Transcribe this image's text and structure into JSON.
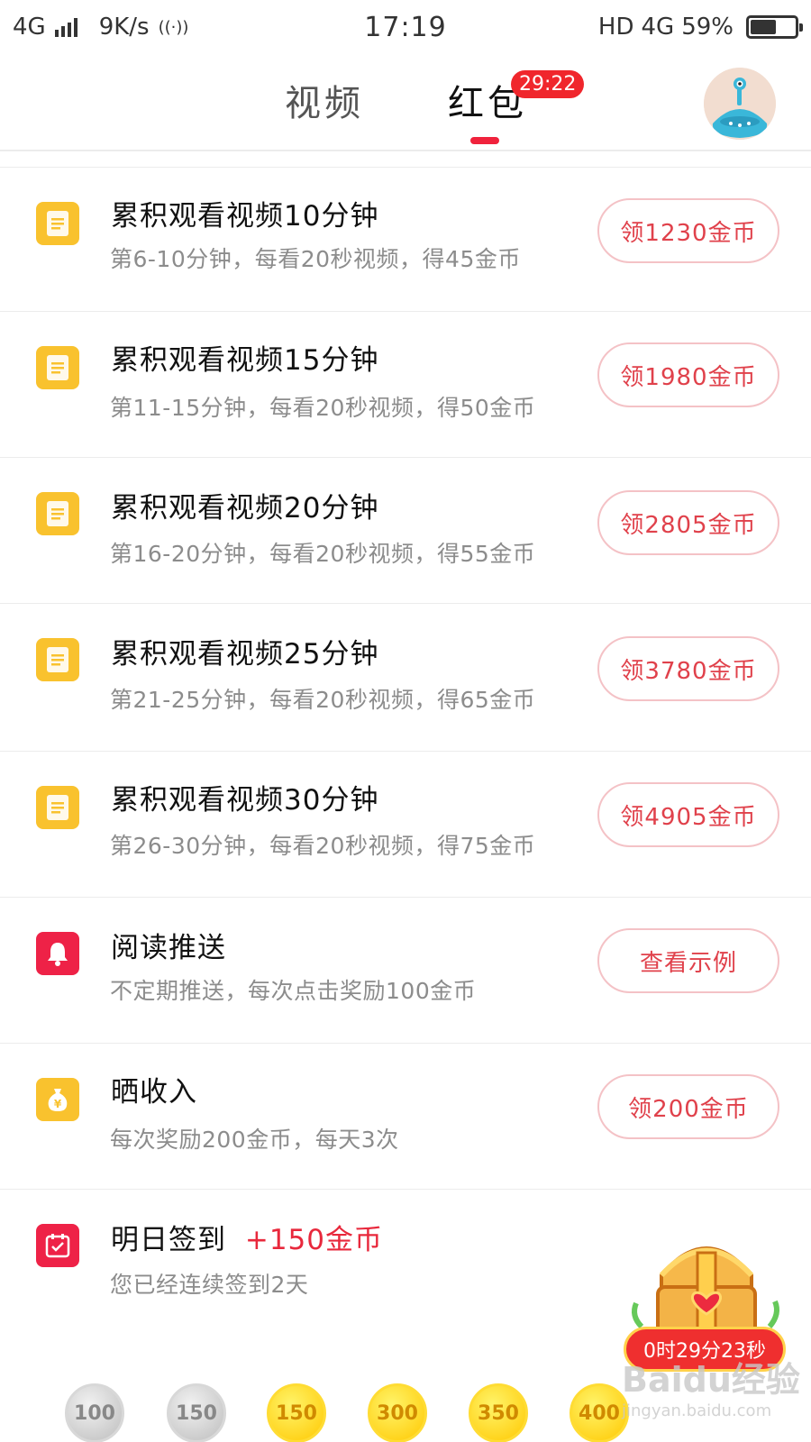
{
  "status_bar": {
    "network": "4G",
    "speed": "9K/s",
    "time": "17:19",
    "hd": "HD",
    "network_right": "4G",
    "battery_text": "59%",
    "battery_level": 0.59
  },
  "header": {
    "tabs": [
      {
        "label": "视频"
      },
      {
        "label": "红包"
      }
    ],
    "active_tab": "红包",
    "timer_badge": "29:22"
  },
  "tasks": [
    {
      "title": "累积观看视频10分钟",
      "desc": "第6-10分钟，每看20秒视频，得45金币",
      "button": "领1230金币",
      "icon": "document-icon",
      "icon_color": "#f9c22e"
    },
    {
      "title": "累积观看视频15分钟",
      "desc": "第11-15分钟，每看20秒视频，得50金币",
      "button": "领1980金币",
      "icon": "document-icon",
      "icon_color": "#f9c22e"
    },
    {
      "title": "累积观看视频20分钟",
      "desc": "第16-20分钟，每看20秒视频，得55金币",
      "button": "领2805金币",
      "icon": "document-icon",
      "icon_color": "#f9c22e"
    },
    {
      "title": "累积观看视频25分钟",
      "desc": "第21-25分钟，每看20秒视频，得65金币",
      "button": "领3780金币",
      "icon": "document-icon",
      "icon_color": "#f9c22e"
    },
    {
      "title": "累积观看视频30分钟",
      "desc": "第26-30分钟，每看20秒视频，得75金币",
      "button": "领4905金币",
      "icon": "document-icon",
      "icon_color": "#f9c22e"
    },
    {
      "title": "阅读推送",
      "desc": "不定期推送，每次点击奖励100金币",
      "button": "查看示例",
      "icon": "bell-icon",
      "icon_color": "#ee2247"
    },
    {
      "title": "晒收入",
      "desc": "每次奖励200金币，每天3次",
      "button": "领200金币",
      "icon": "money-bag-icon",
      "icon_color": "#f9c22e"
    }
  ],
  "checkin": {
    "title": "明日签到",
    "reward": "+150金币",
    "desc": "您已经连续签到2天",
    "icon": "calendar-check-icon",
    "icon_color": "#ee2247"
  },
  "chest": {
    "timer": "0时29分23秒",
    "icon": "treasure-chest-icon"
  },
  "coins": [
    {
      "value": "100",
      "state": "collected"
    },
    {
      "value": "150",
      "state": "collected"
    },
    {
      "value": "150",
      "state": "available"
    },
    {
      "value": "300",
      "state": "available"
    },
    {
      "value": "350",
      "state": "available"
    },
    {
      "value": "400",
      "state": "available"
    }
  ],
  "watermark": {
    "text": "Baidu经验",
    "url": "jingyan.baidu.com"
  },
  "colors": {
    "accent_red": "#e8283c",
    "icon_yellow": "#f9c22e",
    "button_border": "#f4c2c6"
  }
}
